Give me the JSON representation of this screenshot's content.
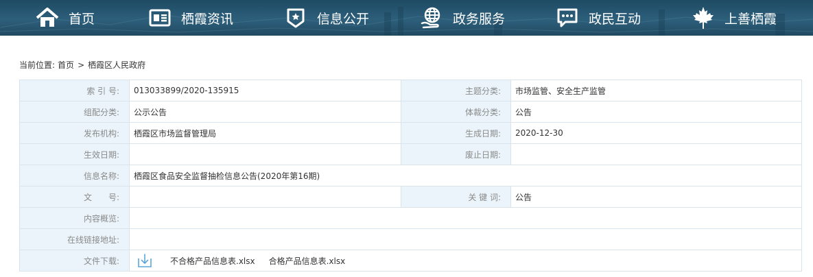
{
  "nav": {
    "items": [
      {
        "label": "首页",
        "icon": "home-icon"
      },
      {
        "label": "栖霞资讯",
        "icon": "news-icon"
      },
      {
        "label": "信息公开",
        "icon": "badge-icon"
      },
      {
        "label": "政务服务",
        "icon": "globe-hand-icon"
      },
      {
        "label": "政民互动",
        "icon": "chat-icon"
      },
      {
        "label": "上善栖霞",
        "icon": "maple-leaf-icon"
      }
    ]
  },
  "breadcrumb": {
    "prefix": "当前位置:",
    "home": "首页",
    "separator": ">",
    "current": "栖霞区人民政府"
  },
  "meta": {
    "index_no": {
      "label": "索 引 号:",
      "value": "013033899/2020-135915"
    },
    "topic": {
      "label": "主题分类:",
      "value": "市场监管、安全生产监管"
    },
    "org_class": {
      "label": "组配分类:",
      "value": "公示公告"
    },
    "genre": {
      "label": "体裁分类:",
      "value": "公告"
    },
    "publisher": {
      "label": "发布机构:",
      "value": "栖霞区市场监督管理局"
    },
    "created": {
      "label": "生成日期:",
      "value": "2020-12-30"
    },
    "effective": {
      "label": "生效日期:",
      "value": ""
    },
    "expired": {
      "label": "废止日期:",
      "value": ""
    },
    "title": {
      "label": "信息名称:",
      "value": "栖霞区食品安全监督抽检信息公告(2020年第16期)"
    },
    "doc_no": {
      "label": "文　　号:",
      "value": ""
    },
    "keywords": {
      "label": "关 键 词:",
      "value": "公告"
    },
    "summary": {
      "label": "内容概览:",
      "value": ""
    },
    "link": {
      "label": "在线链接地址:",
      "value": ""
    },
    "download": {
      "label": "文件下载:",
      "files": [
        "不合格产品信息表.xlsx",
        "合格产品信息表.xlsx"
      ]
    }
  },
  "colors": {
    "nav_bg": "#2d5f7b",
    "label_bg": "#ebf4fb",
    "border": "#d9e3ec",
    "download_icon": "#5aa6dc"
  }
}
